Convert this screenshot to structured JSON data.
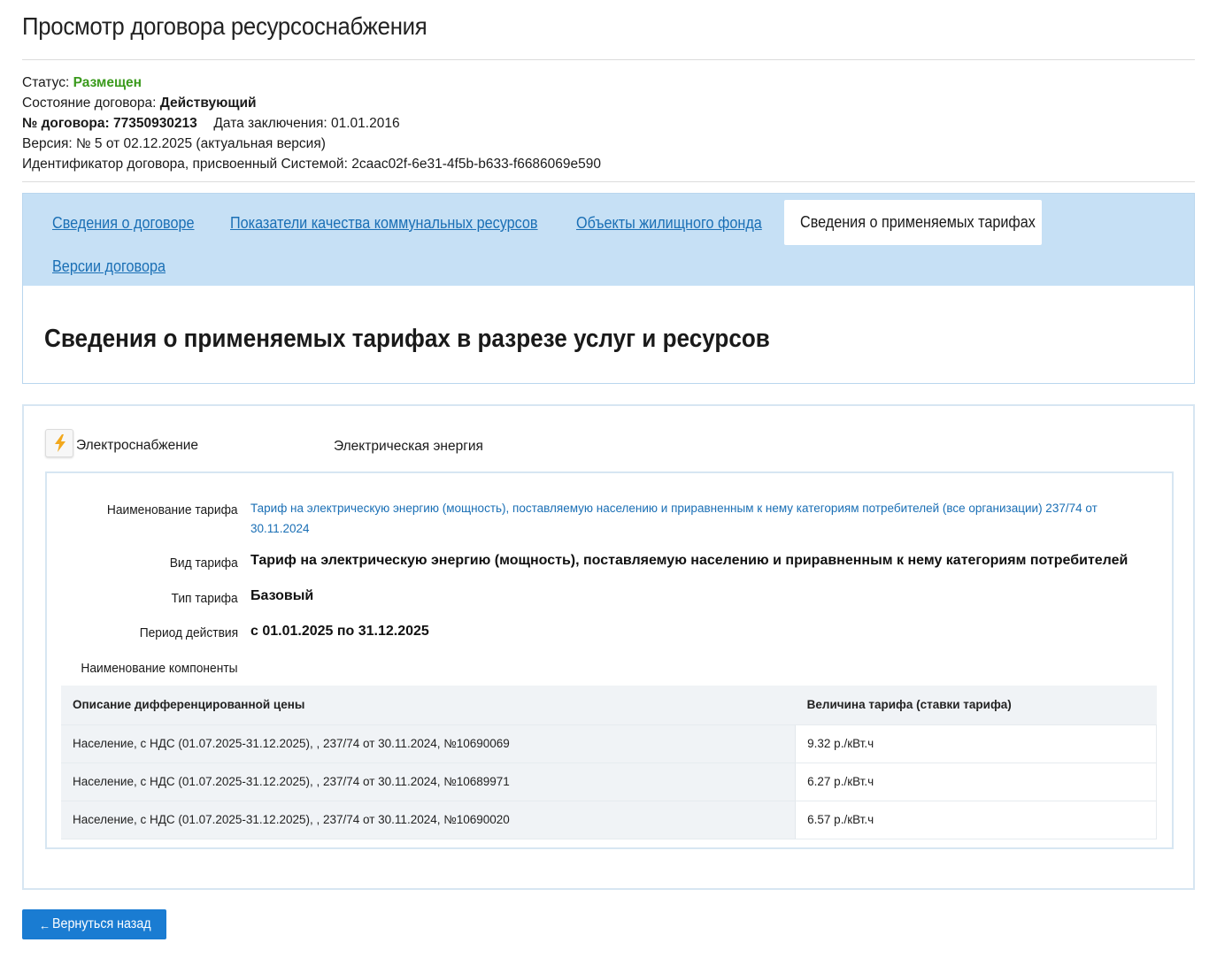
{
  "page": {
    "title": "Просмотр договора ресурсоснабжения"
  },
  "meta": {
    "status_label": "Статус:",
    "status_value": "Размещен",
    "state_label": "Состояние договора:",
    "state_value": "Действующий",
    "number_label": "№ договора:",
    "number_value": "77350930213",
    "date_label": "Дата заключения:",
    "date_value": "01.01.2016",
    "version_text": "Версия: № 5 от 02.12.2025 (актуальная версия)",
    "identifier_label": "Идентификатор договора, присвоенный Системой:",
    "identifier_value": "2caac02f-6e31-4f5b-b633-f6686069e590"
  },
  "tabs": [
    {
      "label": "Сведения о договоре"
    },
    {
      "label": "Показатели качества коммунальных ресурсов"
    },
    {
      "label": "Объекты жилищного фонда"
    },
    {
      "label": "Сведения о применяемых тарифах",
      "active": true
    },
    {
      "label": "Версии договора"
    }
  ],
  "section": {
    "title": "Сведения о применяемых тарифах в разрезе услуг и ресурсов"
  },
  "service": {
    "icon": "lightning-icon",
    "name": "Электроснабжение",
    "resource": "Электрическая энергия"
  },
  "tariff": {
    "name_label": "Наименование тарифа",
    "name_value": "Тариф на электрическую энергию (мощность), поставляемую населению и приравненным к нему категориям потребителей (все организации) 237/74 от 30.11.2024",
    "kind_label": "Вид тарифа",
    "kind_value": "Тариф на электрическую энергию (мощность), поставляемую населению и приравненным к нему категориям потребителей",
    "type_label": "Тип тарифа",
    "type_value": "Базовый",
    "period_label": "Период действия",
    "period_value": "с 01.01.2025 по 31.12.2025",
    "component_label": "Наименование компоненты"
  },
  "table": {
    "headers": [
      "Описание дифференцированной цены",
      "Величина тарифа (ставки тарифа)"
    ],
    "rows": [
      {
        "description": "Население, с НДС (01.07.2025-31.12.2025), , 237/74 от 30.11.2024, №10690069",
        "value": "9.32 р./кВт.ч"
      },
      {
        "description": "Население, с НДС (01.07.2025-31.12.2025), , 237/74 от 30.11.2024, №10689971",
        "value": "6.27 р./кВт.ч"
      },
      {
        "description": "Население, с НДС (01.07.2025-31.12.2025), , 237/74 от 30.11.2024, №10690020",
        "value": "6.57 р./кВт.ч"
      }
    ]
  },
  "back_button": {
    "label": "Вернуться назад",
    "icon": "arrow-left-icon"
  },
  "colors": {
    "accent": "#1a7cd2",
    "link": "#1a6fb5",
    "status_green": "#3a9a1c",
    "tab_bar": "#c6e0f5"
  }
}
